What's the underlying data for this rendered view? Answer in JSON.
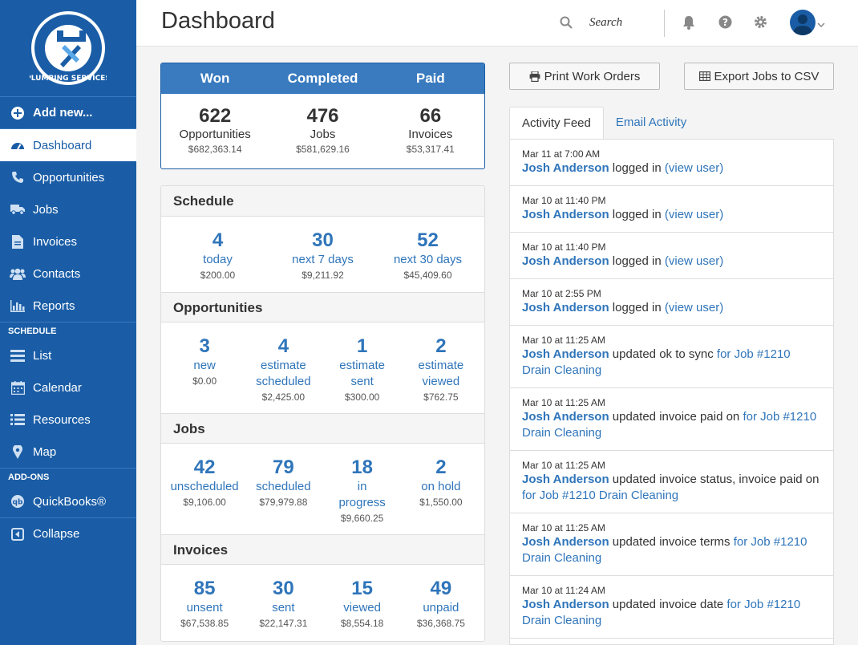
{
  "sidebar": {
    "logo_text": "PLUMBING SERVICES",
    "add_new": "Add new...",
    "items": [
      {
        "label": "Dashboard",
        "icon": "dashboard-icon"
      },
      {
        "label": "Opportunities",
        "icon": "phone-icon"
      },
      {
        "label": "Jobs",
        "icon": "truck-icon"
      },
      {
        "label": "Invoices",
        "icon": "document-icon"
      },
      {
        "label": "Contacts",
        "icon": "users-icon"
      },
      {
        "label": "Reports",
        "icon": "bar-chart-icon"
      }
    ],
    "schedule_label": "SCHEDULE",
    "schedule_items": [
      {
        "label": "List",
        "icon": "list-icon"
      },
      {
        "label": "Calendar",
        "icon": "calendar-icon"
      },
      {
        "label": "Resources",
        "icon": "resources-icon"
      },
      {
        "label": "Map",
        "icon": "map-pin-icon"
      }
    ],
    "addons_label": "ADD-ONS",
    "quickbooks": "QuickBooks®",
    "collapse": "Collapse"
  },
  "header": {
    "title": "Dashboard",
    "search_label": "Search"
  },
  "stats": {
    "headers": [
      "Won",
      "Completed",
      "Paid"
    ],
    "cols": [
      {
        "num": "622",
        "label": "Opportunities",
        "amount": "$682,363.14"
      },
      {
        "num": "476",
        "label": "Jobs",
        "amount": "$581,629.16"
      },
      {
        "num": "66",
        "label": "Invoices",
        "amount": "$53,317.41"
      }
    ]
  },
  "sections": {
    "schedule": {
      "title": "Schedule",
      "cells": [
        {
          "num": "4",
          "label": "today",
          "amount": "$200.00"
        },
        {
          "num": "30",
          "label": "next 7 days",
          "amount": "$9,211.92"
        },
        {
          "num": "52",
          "label": "next 30 days",
          "amount": "$45,409.60"
        }
      ]
    },
    "opportunities": {
      "title": "Opportunities",
      "cells": [
        {
          "num": "3",
          "label1": "new",
          "label2": "",
          "amount": "$0.00"
        },
        {
          "num": "4",
          "label1": "estimate",
          "label2": "scheduled",
          "amount": "$2,425.00"
        },
        {
          "num": "1",
          "label1": "estimate",
          "label2": "sent",
          "amount": "$300.00"
        },
        {
          "num": "2",
          "label1": "estimate",
          "label2": "viewed",
          "amount": "$762.75"
        }
      ]
    },
    "jobs": {
      "title": "Jobs",
      "cells": [
        {
          "num": "42",
          "label1": "unscheduled",
          "label2": "",
          "amount": "$9,106.00"
        },
        {
          "num": "79",
          "label1": "scheduled",
          "label2": "",
          "amount": "$79,979.88"
        },
        {
          "num": "18",
          "label1": "in",
          "label2": "progress",
          "amount": "$9,660.25"
        },
        {
          "num": "2",
          "label1": "on hold",
          "label2": "",
          "amount": "$1,550.00"
        }
      ]
    },
    "invoices": {
      "title": "Invoices",
      "cells": [
        {
          "num": "85",
          "label": "unsent",
          "amount": "$67,538.85"
        },
        {
          "num": "30",
          "label": "sent",
          "amount": "$22,147.31"
        },
        {
          "num": "15",
          "label": "viewed",
          "amount": "$8,554.18"
        },
        {
          "num": "49",
          "label": "unpaid",
          "amount": "$36,368.75"
        }
      ]
    }
  },
  "actions": {
    "print": "Print Work Orders",
    "export": "Export Jobs to CSV"
  },
  "tabs": [
    "Activity Feed",
    "Email Activity"
  ],
  "feed": [
    {
      "date": "Mar 11 at 7:00 AM",
      "user": "Josh Anderson",
      "action": " logged in ",
      "link": "(view user)"
    },
    {
      "date": "Mar 10 at 11:40 PM",
      "user": "Josh Anderson",
      "action": " logged in ",
      "link": "(view user)"
    },
    {
      "date": "Mar 10 at 11:40 PM",
      "user": "Josh Anderson",
      "action": " logged in ",
      "link": "(view user)"
    },
    {
      "date": "Mar 10 at 2:55 PM",
      "user": "Josh Anderson",
      "action": " logged in ",
      "link": "(view user)"
    },
    {
      "date": "Mar 10 at 11:25 AM",
      "user": "Josh Anderson",
      "action": " updated ok to sync ",
      "link": "for Job #1210 Drain Cleaning"
    },
    {
      "date": "Mar 10 at 11:25 AM",
      "user": "Josh Anderson",
      "action": " updated invoice paid on ",
      "link": "for Job #1210 Drain Cleaning"
    },
    {
      "date": "Mar 10 at 11:25 AM",
      "user": "Josh Anderson",
      "action": " updated invoice status, invoice paid on ",
      "link": "for Job #1210 Drain Cleaning"
    },
    {
      "date": "Mar 10 at 11:25 AM",
      "user": "Josh Anderson",
      "action": " updated invoice terms ",
      "link": "for Job #1210 Drain Cleaning"
    },
    {
      "date": "Mar 10 at 11:24 AM",
      "user": "Josh Anderson",
      "action": " updated invoice date ",
      "link": "for Job #1210 Drain Cleaning"
    }
  ]
}
